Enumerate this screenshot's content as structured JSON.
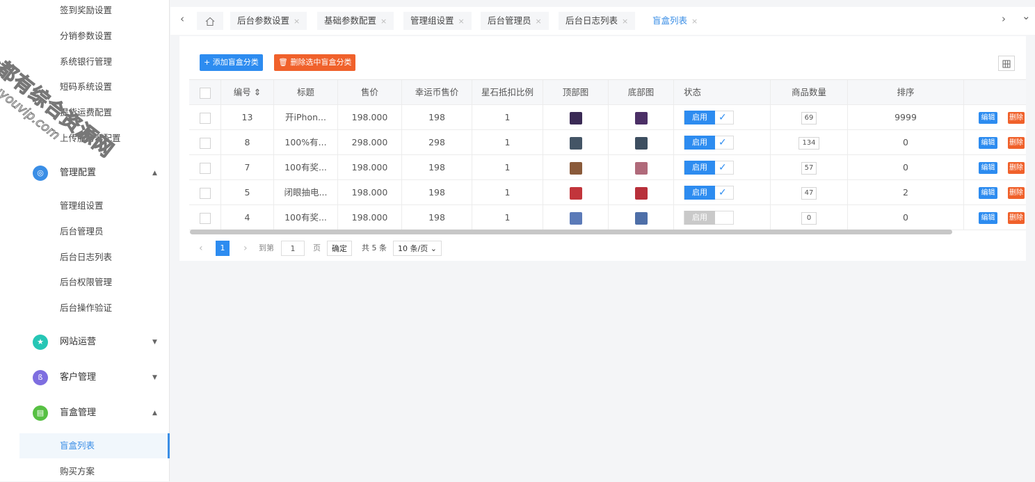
{
  "sidebar": {
    "top_items": [
      "签到奖励设置",
      "分销参数设置",
      "系统银行管理",
      "短码系统设置",
      "提货运费配置",
      "上传服务器配置"
    ],
    "groups": [
      {
        "label": "管理配置",
        "arrow": "▲",
        "color": "#3a8ee6",
        "icon": "shield-icon",
        "glyph": "◎"
      },
      {
        "label": "网站运营",
        "arrow": "▼",
        "color": "#26c6b5",
        "icon": "star-icon",
        "glyph": "★"
      },
      {
        "label": "客户管理",
        "arrow": "▼",
        "color": "#7e6ee0",
        "icon": "user-icon",
        "glyph": "ß"
      },
      {
        "label": "盲盒管理",
        "arrow": "▲",
        "color": "#57c043",
        "icon": "box-icon",
        "glyph": "▤"
      }
    ],
    "mgmt_items": [
      "管理组设置",
      "后台管理员",
      "后台日志列表",
      "后台权限管理",
      "后台操作验证"
    ],
    "box_items": [
      "盲盒列表",
      "购买方案"
    ]
  },
  "watermark": {
    "line1": "全都有综合资源网",
    "line2": "douyouvip.com"
  },
  "tabs": {
    "prev": "‹",
    "home_icon": "home-icon",
    "next": "›",
    "more": "⌄",
    "items": [
      "后台参数设置",
      "基础参数配置",
      "管理组设置",
      "后台管理员",
      "后台日志列表",
      "盲盒列表"
    ],
    "close": "×"
  },
  "toolbar": {
    "add_label": "+ 添加盲盒分类",
    "delete_label": "🗑 删除选中盲盒分类",
    "grid_icon": "columns-icon"
  },
  "table": {
    "headers": [
      "编号 ⇕",
      "标题",
      "售价",
      "幸运币售价",
      "星石抵扣比例",
      "顶部图",
      "底部图",
      "状态",
      "商品数量",
      "排序",
      ""
    ],
    "rows": [
      {
        "id": "13",
        "title": "开iPhon...",
        "price": "198.000",
        "coin": "198",
        "ratio": "1",
        "top_color": "#3a2a55",
        "bottom_color": "#4b2f66",
        "status": "启用",
        "enabled": true,
        "qty": "69",
        "sort": "9999"
      },
      {
        "id": "8",
        "title": "100%有...",
        "price": "298.000",
        "coin": "298",
        "ratio": "1",
        "top_color": "#445566",
        "bottom_color": "#3d4e60",
        "status": "启用",
        "enabled": true,
        "qty": "134",
        "sort": "0"
      },
      {
        "id": "7",
        "title": "100有奖...",
        "price": "198.000",
        "coin": "198",
        "ratio": "1",
        "top_color": "#8a5a3a",
        "bottom_color": "#b06a7a",
        "status": "启用",
        "enabled": true,
        "qty": "57",
        "sort": "0"
      },
      {
        "id": "5",
        "title": "闭眼抽电...",
        "price": "198.000",
        "coin": "198",
        "ratio": "1",
        "top_color": "#c2353b",
        "bottom_color": "#b8303a",
        "status": "启用",
        "enabled": true,
        "qty": "47",
        "sort": "2"
      },
      {
        "id": "4",
        "title": "100有奖...",
        "price": "198.000",
        "coin": "198",
        "ratio": "1",
        "top_color": "#5b7ab8",
        "bottom_color": "#4e6fa8",
        "status": "启用",
        "enabled": false,
        "qty": "0",
        "sort": "0"
      }
    ],
    "edit_label": "编辑",
    "delete_label": "删除",
    "check_glyph": "✓"
  },
  "pager": {
    "prev": "‹",
    "page": "1",
    "next": "›",
    "goto": "到第",
    "page_input": "1",
    "page_unit": "页",
    "confirm": "确定",
    "total": "共 5 条",
    "page_size": "10 条/页"
  },
  "colors": {
    "primary": "#2d8cf0",
    "danger": "#f0612b",
    "active_tab": "#3a8ee6"
  }
}
